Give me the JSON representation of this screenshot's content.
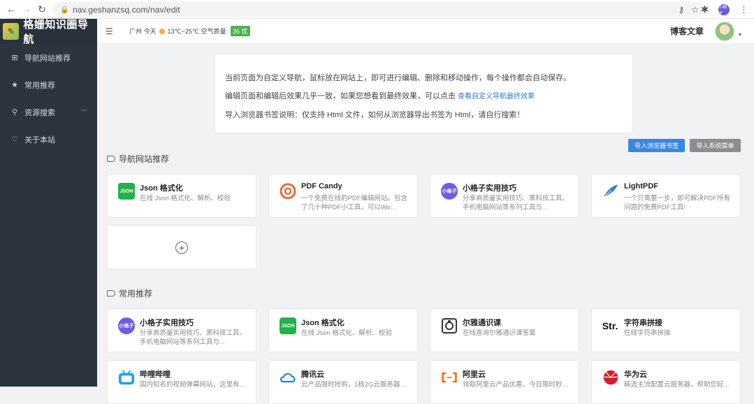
{
  "browser": {
    "url": "nav.geshanzsq.com/nav/edit",
    "profile_label": "小格子"
  },
  "sidebar": {
    "brand_title": "格姗知识圈导航",
    "items": [
      {
        "label": "导航网站推荐",
        "icon": "grid-icon"
      },
      {
        "label": "常用推荐",
        "icon": "star-icon"
      },
      {
        "label": "资源搜索",
        "icon": "search-icon"
      },
      {
        "label": "关于本站",
        "icon": "heart-icon"
      }
    ]
  },
  "header": {
    "weather_text": "广州 今天",
    "temp_text": "13℃~25℃ 空气质量:",
    "aqi": "36 优",
    "blog_link": "博客文章"
  },
  "notice": {
    "line1": "当前页面为自定义导航，鼠标放在网站上，即可进行编辑、删除和移动操作，每个操作都会自动保存。",
    "line2_prefix": "编辑页面和编辑后效果几乎一致，如果您想看到最终效果，可以点击",
    "line2_link": "查看自定义导航最终效果",
    "line3": "导入浏览器书签说明：仅支持 Html 文件，如何从浏览器导出书签为 Html，请自行搜索！"
  },
  "buttons": {
    "import_bookmarks": "导入浏览器书签",
    "import_system": "导入系统菜单"
  },
  "sections": [
    {
      "title": "导航网站推荐",
      "cards": [
        {
          "title": "Json 格式化",
          "desc": "在线 Json 格式化、解析、校验",
          "icon_text": "JSON",
          "icon_color": "#22b14c"
        },
        {
          "title": "PDF Candy",
          "desc": "一个免费在线的PDF编辑网站。包含了几十种PDF小工具，可以Wo...",
          "icon_text": "",
          "icon_color": "#e8673a"
        },
        {
          "title": "小格子实用技巧",
          "desc": "分享高质量实用技巧、黑科技工具、手机电脑网站等系列工具与...",
          "icon_text": "小格子",
          "icon_color": "#6c5ce7"
        },
        {
          "title": "LightPDF",
          "desc": "一个只需要一步，即可解决PDF所有问题的免费PDF工具!",
          "icon_text": "",
          "icon_color": "#2d7be0"
        }
      ]
    },
    {
      "title": "常用推荐",
      "cards": [
        {
          "title": "小格子实用技巧",
          "desc": "分享高质量实用技巧、黑科技工具、手机电脑网站等系列工具与...",
          "icon_text": "小格子",
          "icon_color": "#6c5ce7"
        },
        {
          "title": "Json 格式化",
          "desc": "在线 Json 格式化、解析、校验",
          "icon_text": "JSON",
          "icon_color": "#22b14c"
        },
        {
          "title": "尔雅通识课",
          "desc": "在线查询尔雅通识课答案",
          "icon_text": "",
          "icon_color": "#333333"
        },
        {
          "title": "字符串拼接",
          "desc": "在线字符串拼接",
          "icon_text": "Str.",
          "icon_color": "#ffffff"
        },
        {
          "title": "哔哩哔哩",
          "desc": "国内知名的视频弹幕网站，这里有...",
          "icon_text": "",
          "icon_color": "#1fa4e6"
        },
        {
          "title": "腾讯云",
          "desc": "云产品限时抢购，1核2G云服务器...",
          "icon_text": "",
          "icon_color": "#1f7ee0"
        },
        {
          "title": "阿里云",
          "desc": "领取阿里云产品优惠，今日限时秒...",
          "icon_text": "",
          "icon_color": "#ff6a00"
        },
        {
          "title": "华为云",
          "desc": "精选主流配置云服务器，帮助您轻...",
          "icon_text": "",
          "icon_color": "#d71d25"
        }
      ]
    }
  ]
}
